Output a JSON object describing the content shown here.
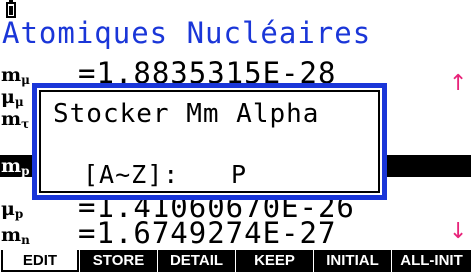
{
  "status_bar": {
    "icon": "battery-icon"
  },
  "title": "Atomiques Nucléaires",
  "rows": [
    {
      "sym": "m",
      "sub": "μ",
      "value": "=1.8835315E-28"
    },
    {
      "sym": "μ",
      "sub": "μ",
      "value": ""
    },
    {
      "sym": "m",
      "sub": "τ",
      "value": ""
    },
    {
      "sym": "m",
      "sub": "p",
      "value": ""
    },
    {
      "sym": "μ",
      "sub": "p",
      "value": "=1.41060670E-26"
    },
    {
      "sym": "m",
      "sub": "n",
      "value": "=1.6749274E-27"
    }
  ],
  "selected_row": 3,
  "scroll": {
    "up": "↑",
    "down": "↓"
  },
  "dialog": {
    "title": "Stocker Mm Alpha",
    "prompt": "[A~Z]:",
    "value": "P"
  },
  "fkeys": [
    "EDIT",
    "STORE",
    "DETAIL",
    "KEEP",
    "INITIAL",
    "ALL-INIT"
  ],
  "colors": {
    "accent": "#1a36d8",
    "arrow": "#e8247a"
  }
}
